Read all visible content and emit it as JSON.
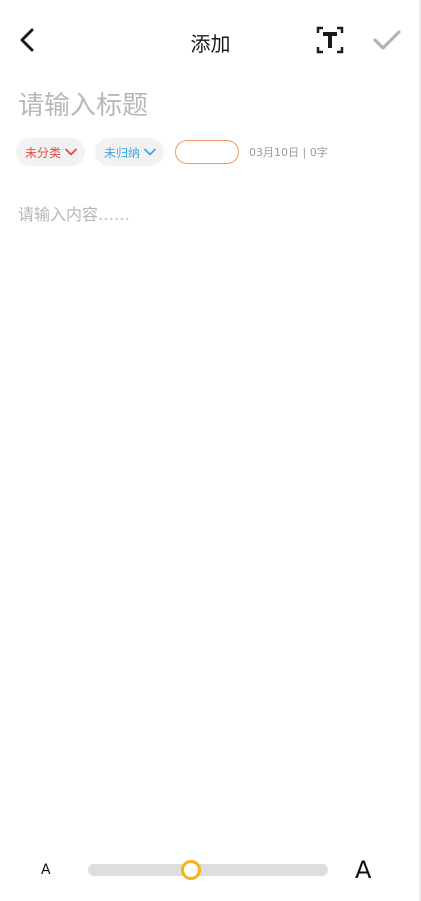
{
  "header": {
    "title": "添加",
    "back_icon": "chevron-left-icon",
    "text_format_icon": "text-format-icon",
    "confirm_icon": "checkmark-icon"
  },
  "note": {
    "title_placeholder": "请输入标题",
    "content_placeholder": "请输入内容……"
  },
  "meta": {
    "category_label": "未分类",
    "category_color": "#e84b3c",
    "archive_label": "未归纳",
    "archive_color": "#3fa7e6",
    "tag_border_color": "#f39a62",
    "info": "03月10日 | 0字"
  },
  "font_size": {
    "small_label": "A",
    "large_label": "A",
    "level": 0.43,
    "accent": "#f7b21b"
  }
}
